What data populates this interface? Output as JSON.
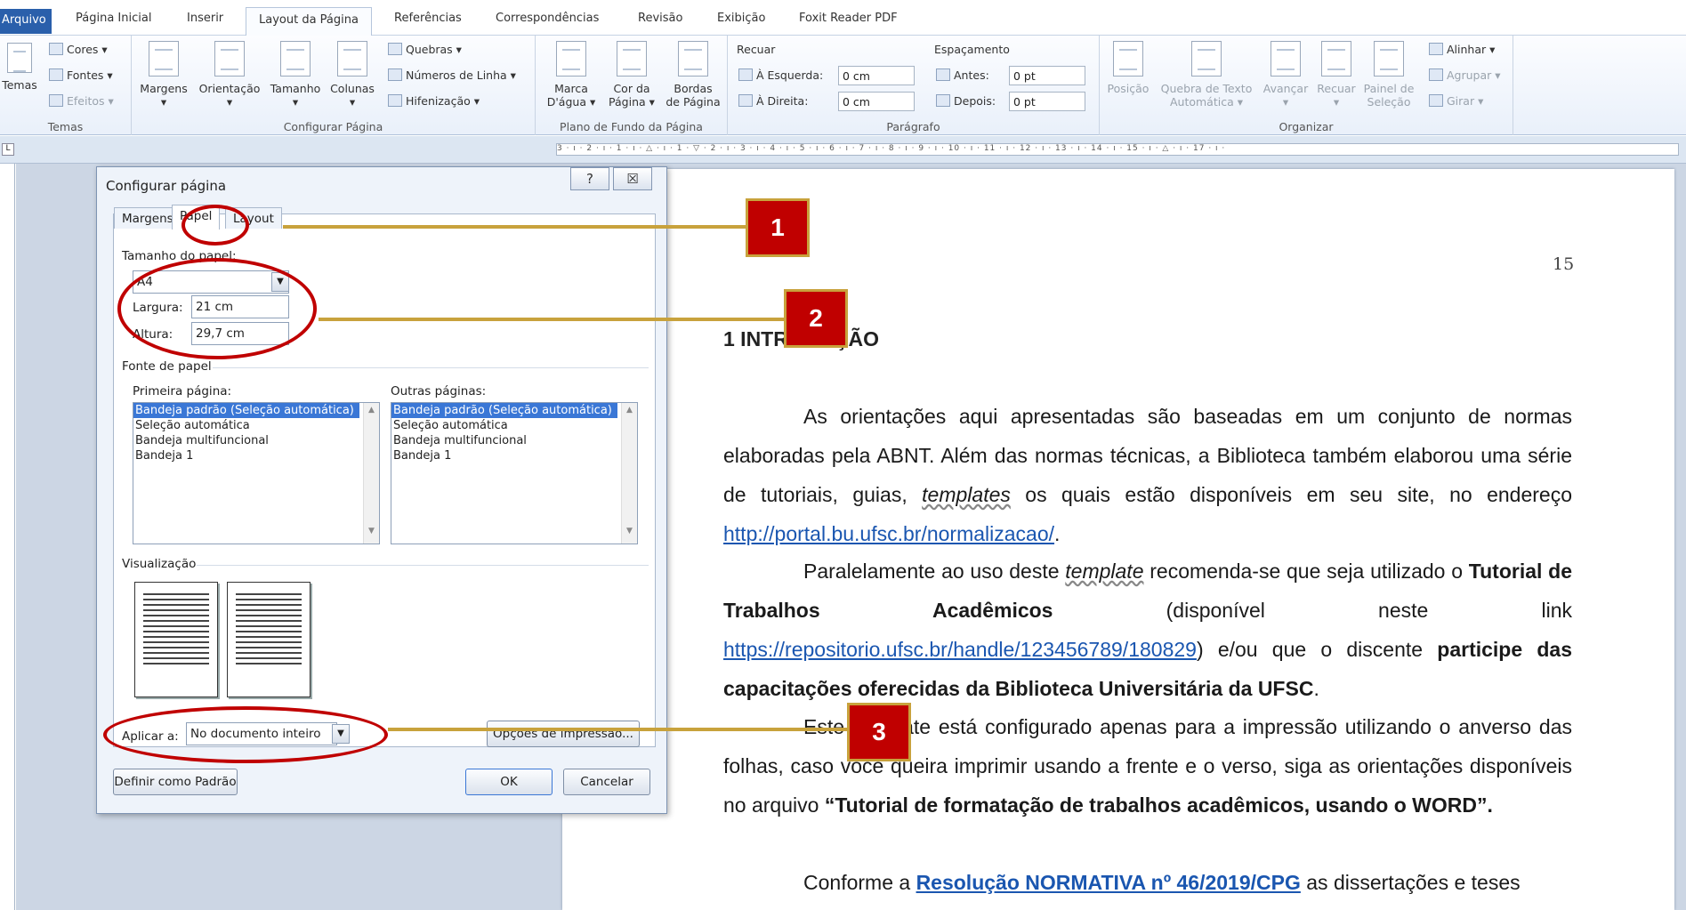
{
  "ribbon_tabs": [
    "Arquivo",
    "Página Inicial",
    "Inserir",
    "Layout da Página",
    "Referências",
    "Correspondências",
    "Revisão",
    "Exibição",
    "Foxit Reader PDF"
  ],
  "ribbon": {
    "temas": {
      "label": "Temas",
      "big": "Temas",
      "cores": "Cores",
      "fontes": "Fontes",
      "efeitos": "Efeitos"
    },
    "configurar": {
      "label": "Configurar Página",
      "margens": "Margens",
      "orientacao": "Orientação",
      "tamanho": "Tamanho",
      "colunas": "Colunas",
      "quebras": "Quebras",
      "numeros": "Números de Linha",
      "hifenizacao": "Hifenização"
    },
    "plano": {
      "label": "Plano de Fundo da Página",
      "marca1": "Marca",
      "marca2": "D'água",
      "cor1": "Cor da",
      "cor2": "Página",
      "bordas1": "Bordas",
      "bordas2": "de Página"
    },
    "paragrafo": {
      "label": "Parágrafo",
      "recuar": "Recuar",
      "esquerda_label": "À Esquerda:",
      "esquerda_value": "0 cm",
      "direita_label": "À Direita:",
      "direita_value": "0 cm",
      "espacamento": "Espaçamento",
      "antes_label": "Antes:",
      "antes_value": "0 pt",
      "depois_label": "Depois:",
      "depois_value": "0 pt"
    },
    "organizar": {
      "label": "Organizar",
      "posicao": "Posição",
      "quebra1": "Quebra de Texto",
      "quebra2": "Automática",
      "avancar": "Avançar",
      "recuar": "Recuar",
      "painel1": "Painel de",
      "painel2": "Seleção",
      "alinhar": "Alinhar",
      "agrupar": "Agrupar",
      "girar": "Girar"
    }
  },
  "ruler_text": "3 · ı · 2 · ı · 1 · ı · △ · ı · 1 · ▽ · 2 · ı · 3 · ı · 4 · ı · 5 · ı · 6 · ı · 7 · ı · 8 · ı · 9 · ı · 10 · ı · 11 · ı · 12 · ı · 13 · ı · 14 · ı · 15 · ı · △ · ı · 17 · ı ·",
  "document": {
    "page_number": "15",
    "heading": "1 INTRODUÇÃO",
    "p1_a": "As orientações aqui apresentadas são baseadas em um conjunto de normas elaboradas pela ABNT. Além das normas técnicas, a Biblioteca também elaborou uma série de tutoriais, guias, ",
    "p1_em": "templates",
    "p1_b": " os quais estão disponíveis em seu site, no endereço ",
    "p1_link": "http://portal.bu.ufsc.br/normalizacao/",
    "p1_c": ".",
    "p2_a": "Paralelamente ao uso deste ",
    "p2_em": "template",
    "p2_b": " recomenda-se que seja utilizado o ",
    "p2_strong": "Tutorial de Trabalhos Acadêmicos",
    "p2_c": " (disponível neste link ",
    "p2_link": "https://repositorio.ufsc.br/handle/123456789/180829",
    "p2_d": ") e/ou que o discente ",
    "p2_strong2": "participe das capacitações oferecidas da Biblioteca Universitária da UFSC",
    "p2_e": ".",
    "p3_a": "Este template está configurado apenas para a impressão utilizando o anverso das folhas, caso você queira imprimir usando a frente e o verso, siga as orientações disponíveis no arquivo ",
    "p3_strong": "“Tutorial de formatação de trabalhos acadêmicos, usando o WORD”.",
    "p4_a": "Conforme a ",
    "p4_link": "Resolução NORMATIVA nº 46/2019/CPG",
    "p4_b": " as dissertações e teses"
  },
  "dialog": {
    "title": "Configurar página",
    "help": "?",
    "close": "☒",
    "tabs": [
      "Margens",
      "Papel",
      "Layout"
    ],
    "paper_size_label": "Tamanho do papel:",
    "paper_size_value": "A4",
    "largura_label": "Largura:",
    "largura_value": "21 cm",
    "altura_label": "Altura:",
    "altura_value": "29,7 cm",
    "fonte_label": "Fonte de papel",
    "primeira_label": "Primeira página:",
    "outras_label": "Outras páginas:",
    "tray_options": [
      "Bandeja padrão (Seleção automática)",
      "Seleção automática",
      "Bandeja multifuncional",
      "Bandeja 1"
    ],
    "visualizacao_label": "Visualização",
    "aplicar_label": "Aplicar a:",
    "aplicar_value": "No documento inteiro",
    "opcoes_button": "Opções de impressão...",
    "padrao_button": "Definir como Padrão",
    "ok_button": "OK",
    "cancel_button": "Cancelar"
  },
  "callouts": [
    "1",
    "2",
    "3"
  ],
  "colors": {
    "annotation_red": "#c00000",
    "annotation_gold": "#c8a23c",
    "file_tab": "#2a5fab",
    "link": "#1a56b0"
  }
}
